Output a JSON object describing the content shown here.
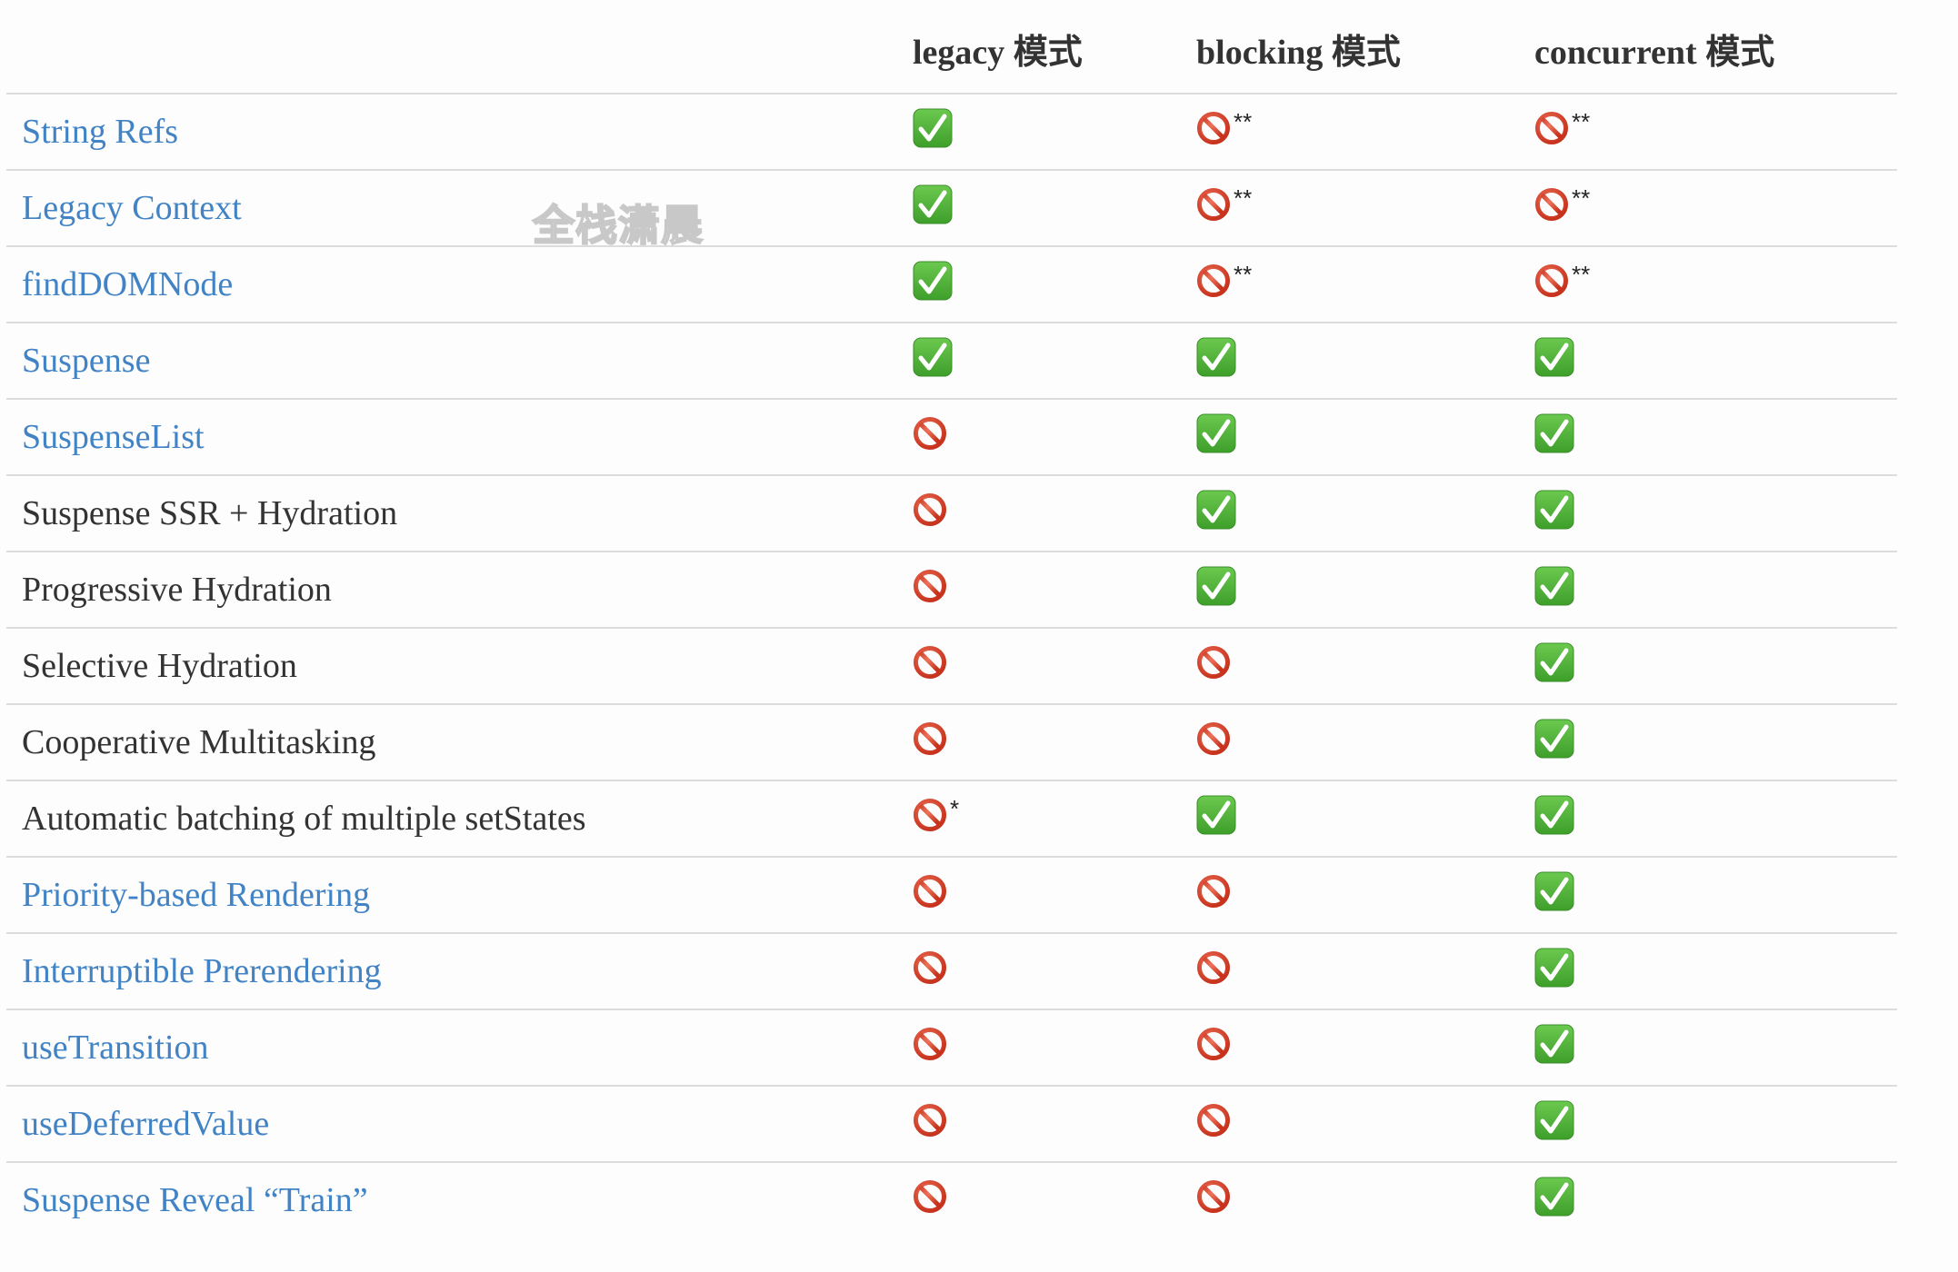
{
  "table": {
    "columns": [
      "",
      "legacy 模式",
      "blocking 模式",
      "concurrent 模式"
    ],
    "rows": [
      {
        "feature": "String Refs",
        "is_link": true,
        "legacy": {
          "status": "supported",
          "note": ""
        },
        "blocking": {
          "status": "unsupported",
          "note": "**"
        },
        "concurrent": {
          "status": "unsupported",
          "note": "**"
        }
      },
      {
        "feature": "Legacy Context",
        "is_link": true,
        "legacy": {
          "status": "supported",
          "note": ""
        },
        "blocking": {
          "status": "unsupported",
          "note": "**"
        },
        "concurrent": {
          "status": "unsupported",
          "note": "**"
        }
      },
      {
        "feature": "findDOMNode",
        "is_link": true,
        "legacy": {
          "status": "supported",
          "note": ""
        },
        "blocking": {
          "status": "unsupported",
          "note": "**"
        },
        "concurrent": {
          "status": "unsupported",
          "note": "**"
        }
      },
      {
        "feature": "Suspense",
        "is_link": true,
        "legacy": {
          "status": "supported",
          "note": ""
        },
        "blocking": {
          "status": "supported",
          "note": ""
        },
        "concurrent": {
          "status": "supported",
          "note": ""
        }
      },
      {
        "feature": "SuspenseList",
        "is_link": true,
        "legacy": {
          "status": "unsupported",
          "note": ""
        },
        "blocking": {
          "status": "supported",
          "note": ""
        },
        "concurrent": {
          "status": "supported",
          "note": ""
        }
      },
      {
        "feature": "Suspense SSR + Hydration",
        "is_link": false,
        "legacy": {
          "status": "unsupported",
          "note": ""
        },
        "blocking": {
          "status": "supported",
          "note": ""
        },
        "concurrent": {
          "status": "supported",
          "note": ""
        }
      },
      {
        "feature": "Progressive Hydration",
        "is_link": false,
        "legacy": {
          "status": "unsupported",
          "note": ""
        },
        "blocking": {
          "status": "supported",
          "note": ""
        },
        "concurrent": {
          "status": "supported",
          "note": ""
        }
      },
      {
        "feature": "Selective Hydration",
        "is_link": false,
        "legacy": {
          "status": "unsupported",
          "note": ""
        },
        "blocking": {
          "status": "unsupported",
          "note": ""
        },
        "concurrent": {
          "status": "supported",
          "note": ""
        }
      },
      {
        "feature": "Cooperative Multitasking",
        "is_link": false,
        "legacy": {
          "status": "unsupported",
          "note": ""
        },
        "blocking": {
          "status": "unsupported",
          "note": ""
        },
        "concurrent": {
          "status": "supported",
          "note": ""
        }
      },
      {
        "feature": "Automatic batching of multiple setStates",
        "is_link": false,
        "legacy": {
          "status": "unsupported",
          "note": "*"
        },
        "blocking": {
          "status": "supported",
          "note": ""
        },
        "concurrent": {
          "status": "supported",
          "note": ""
        }
      },
      {
        "feature": "Priority-based Rendering",
        "is_link": true,
        "legacy": {
          "status": "unsupported",
          "note": ""
        },
        "blocking": {
          "status": "unsupported",
          "note": ""
        },
        "concurrent": {
          "status": "supported",
          "note": ""
        }
      },
      {
        "feature": "Interruptible Prerendering",
        "is_link": true,
        "legacy": {
          "status": "unsupported",
          "note": ""
        },
        "blocking": {
          "status": "unsupported",
          "note": ""
        },
        "concurrent": {
          "status": "supported",
          "note": ""
        }
      },
      {
        "feature": "useTransition",
        "is_link": true,
        "legacy": {
          "status": "unsupported",
          "note": ""
        },
        "blocking": {
          "status": "unsupported",
          "note": ""
        },
        "concurrent": {
          "status": "supported",
          "note": ""
        }
      },
      {
        "feature": "useDeferredValue",
        "is_link": true,
        "legacy": {
          "status": "unsupported",
          "note": ""
        },
        "blocking": {
          "status": "unsupported",
          "note": ""
        },
        "concurrent": {
          "status": "supported",
          "note": ""
        }
      },
      {
        "feature": "Suspense Reveal “Train”",
        "is_link": true,
        "legacy": {
          "status": "unsupported",
          "note": ""
        },
        "blocking": {
          "status": "unsupported",
          "note": ""
        },
        "concurrent": {
          "status": "supported",
          "note": ""
        }
      }
    ]
  },
  "icons": {
    "supported": "check-mark-button-icon",
    "unsupported": "prohibited-icon"
  },
  "colors": {
    "link": "#4183c4",
    "text": "#333333",
    "divider": "#dcdcdc",
    "check_green": "#4fb33b",
    "prohibited_red": "#d9412a"
  },
  "watermark": "全栈潇晨"
}
